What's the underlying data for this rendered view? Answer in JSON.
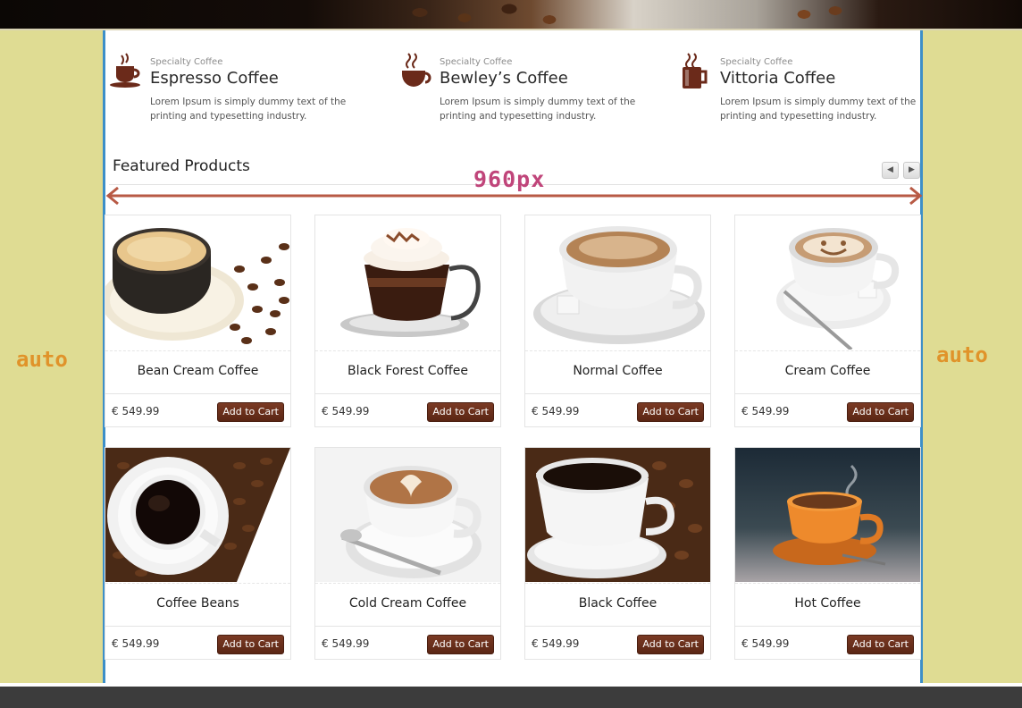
{
  "features": [
    {
      "subtitle": "Specialty Coffee",
      "title": "Espresso Coffee",
      "desc": "Lorem Ipsum is simply dummy text of the printing and typesetting industry.",
      "icon": "coffee-cup-icon"
    },
    {
      "subtitle": "Specialty Coffee",
      "title": "Bewley’s Coffee",
      "desc": "Lorem Ipsum is simply dummy text of the printing and typesetting industry.",
      "icon": "coffee-mug-icon"
    },
    {
      "subtitle": "Specialty Coffee",
      "title": "Vittoria Coffee",
      "desc": "Lorem Ipsum is simply dummy text of the printing and typesetting industry.",
      "icon": "coffee-glass-icon"
    }
  ],
  "featured": {
    "title": "Featured Products",
    "prev_icon": "chevron-left-icon",
    "next_icon": "chevron-right-icon"
  },
  "annotations": {
    "width_label": "960px",
    "left_label": "auto",
    "right_label": "auto",
    "arrow_color": "#b85a45",
    "label_color": "#c0457a",
    "side_color": "#e0932a"
  },
  "products": [
    {
      "name": "Bean Cream Coffee",
      "price": "€ 549.99",
      "cart": "Add to Cart"
    },
    {
      "name": "Black Forest Coffee",
      "price": "€ 549.99",
      "cart": "Add to Cart"
    },
    {
      "name": "Normal Coffee",
      "price": "€ 549.99",
      "cart": "Add to Cart"
    },
    {
      "name": "Cream Coffee",
      "price": "€ 549.99",
      "cart": "Add to Cart"
    },
    {
      "name": "Coffee Beans",
      "price": "€ 549.99",
      "cart": "Add to Cart"
    },
    {
      "name": "Cold Cream Coffee",
      "price": "€ 549.99",
      "cart": "Add to Cart"
    },
    {
      "name": "Black Coffee",
      "price": "€ 549.99",
      "cart": "Add to Cart"
    },
    {
      "name": "Hot Coffee",
      "price": "€ 549.99",
      "cart": "Add to Cart"
    }
  ],
  "colors": {
    "accent_border": "#3d8fc8",
    "cart_button": "#5a2614",
    "page_background": "#dfdc93",
    "footer": "#3c3c3c"
  }
}
